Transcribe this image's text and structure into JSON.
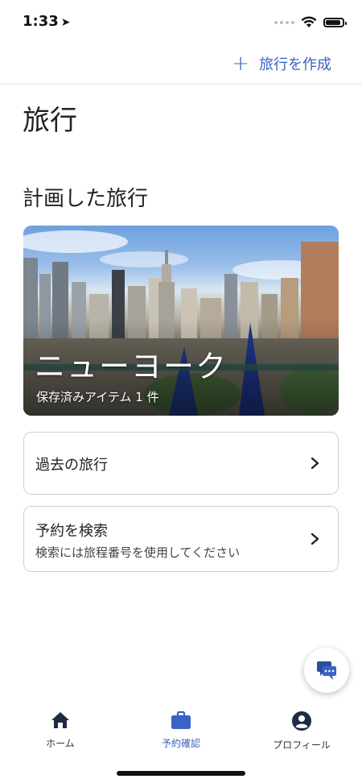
{
  "status_bar": {
    "time": "1:33"
  },
  "header": {
    "create_trip_label": "旅行を作成"
  },
  "page": {
    "title": "旅行",
    "section_title": "計画した旅行"
  },
  "trip_card": {
    "name": "ニューヨーク",
    "saved_items": "保存済みアイテム 1 件"
  },
  "past_trips": {
    "label": "過去の旅行"
  },
  "search_booking": {
    "label": "予約を検索",
    "description": "検索には旅程番号を使用してください"
  },
  "tabbar": {
    "items": [
      {
        "label": "ホーム",
        "icon": "home-icon"
      },
      {
        "label": "予約確認",
        "icon": "briefcase-icon",
        "active": true
      },
      {
        "label": "プロフィール",
        "icon": "profile-icon"
      }
    ]
  },
  "colors": {
    "accent": "#3b63c4"
  }
}
